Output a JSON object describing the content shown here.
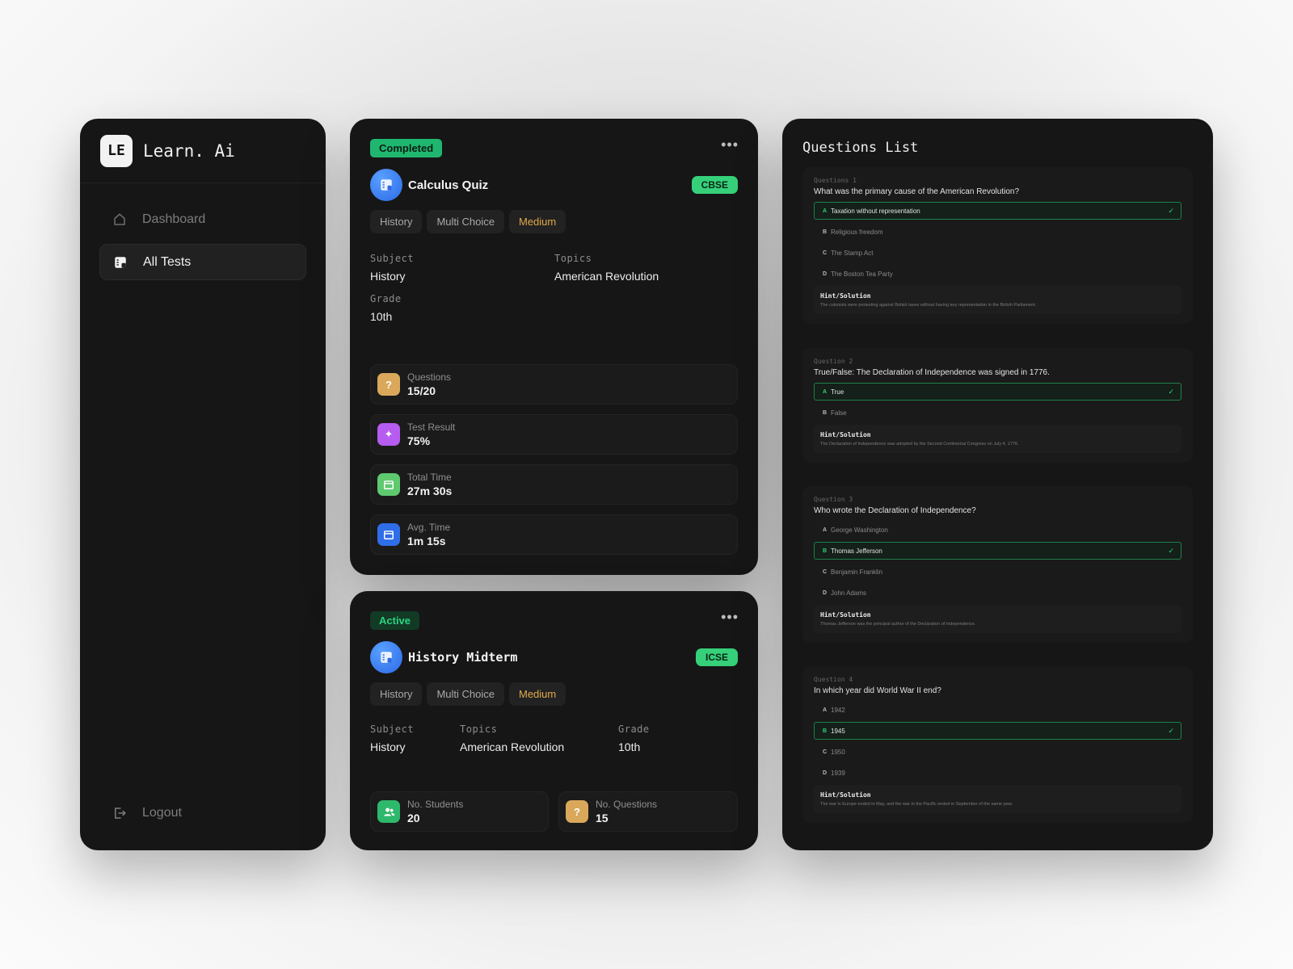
{
  "brand": {
    "logo": "LE",
    "name": "Learn. Ai"
  },
  "nav": [
    {
      "label": "Dashboard",
      "icon": "home-icon",
      "active": false
    },
    {
      "label": "All Tests",
      "icon": "tests-icon",
      "active": true
    }
  ],
  "logout": {
    "label": "Logout",
    "icon": "logout-icon"
  },
  "card1": {
    "status": "Completed",
    "more": "•••",
    "title": "Calculus Quiz",
    "board": "CBSE",
    "tags": [
      "History",
      "Multi Choice",
      "Medium"
    ],
    "subject_label": "Subject",
    "subject": "History",
    "topics_label": "Topics",
    "topics": "American Revolution",
    "grade_label": "Grade",
    "grade": "10th",
    "stats": [
      {
        "label": "Questions",
        "value": "15/20",
        "icon": "question-icon",
        "color": "#d9a85a"
      },
      {
        "label": "Test Result",
        "value": "75%",
        "icon": "sparkle-icon",
        "color": "#b65cf0"
      },
      {
        "label": "Total Time",
        "value": "27m 30s",
        "icon": "calendar-icon",
        "color": "#5fc96f"
      },
      {
        "label": "Avg. Time",
        "value": "1m 15s",
        "icon": "calendar-icon",
        "color": "#2f6ee8"
      }
    ]
  },
  "card2": {
    "status": "Active",
    "more": "•••",
    "title": "History Midterm",
    "board": "ICSE",
    "tags": [
      "History",
      "Multi Choice",
      "Medium"
    ],
    "subject_label": "Subject",
    "subject": "History",
    "topics_label": "Topics",
    "topics": "American Revolution",
    "grade_label": "Grade",
    "grade": "10th",
    "stats": [
      {
        "label": "No. Students",
        "value": "20",
        "icon": "users-icon",
        "color": "#2eb86b"
      },
      {
        "label": "No. Questions",
        "value": "15",
        "icon": "question-icon",
        "color": "#d9a85a"
      }
    ]
  },
  "questions": {
    "title": "Questions List",
    "hint_label": "Hint/Solution",
    "items": [
      {
        "num": "Questions 1",
        "text": "What was the primary cause of the American Revolution?",
        "options": [
          {
            "letter": "A",
            "text": "Taxation without representation",
            "correct": true
          },
          {
            "letter": "B",
            "text": "Religious freedom",
            "correct": false
          },
          {
            "letter": "C",
            "text": "The Stamp Act",
            "correct": false
          },
          {
            "letter": "D",
            "text": "The Boston Tea Party",
            "correct": false
          }
        ],
        "hint": "The colonists were protesting against British taxes without having any representation in the British Parliament."
      },
      {
        "num": "Question 2",
        "text": "True/False: The Declaration of Independence was signed in 1776.",
        "options": [
          {
            "letter": "A",
            "text": "True",
            "correct": true
          },
          {
            "letter": "B",
            "text": "False",
            "correct": false
          }
        ],
        "hint": "The Declaration of Independence was adopted by the Second Continental Congress on July 4, 1776."
      },
      {
        "num": "Question 3",
        "text": "Who wrote the Declaration of Independence?",
        "options": [
          {
            "letter": "A",
            "text": "George Washington",
            "correct": false
          },
          {
            "letter": "B",
            "text": "Thomas Jefferson",
            "correct": true
          },
          {
            "letter": "C",
            "text": "Benjamin Franklin",
            "correct": false
          },
          {
            "letter": "D",
            "text": "John Adams",
            "correct": false
          }
        ],
        "hint": "Thomas Jefferson was the principal author of the Declaration of Independence."
      },
      {
        "num": "Question 4",
        "text": "In which year did World War II end?",
        "options": [
          {
            "letter": "A",
            "text": "1942",
            "correct": false
          },
          {
            "letter": "B",
            "text": "1945",
            "correct": true
          },
          {
            "letter": "C",
            "text": "1950",
            "correct": false
          },
          {
            "letter": "D",
            "text": "1939",
            "correct": false
          }
        ],
        "hint": "The war in Europe ended in May, and the war in the Pacific ended in September of the same year."
      }
    ]
  }
}
